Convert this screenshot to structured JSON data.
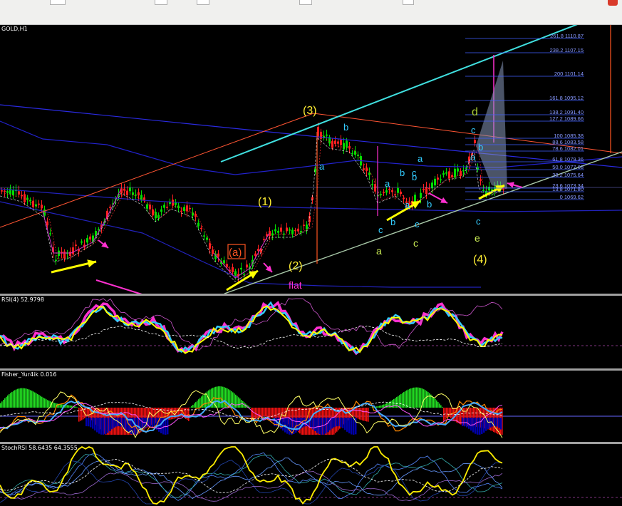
{
  "chart": {
    "symbol_label": "GOLD,H1",
    "wave_labels": {
      "w3": "(3)",
      "w1": "(1)",
      "w2": "(2)",
      "wa_paren": "(a)",
      "w4": "(4)",
      "flat": "flat",
      "d": "d",
      "a1": "a",
      "b1": "b",
      "a2": "a",
      "b2": "b",
      "c1": "c",
      "b3": "b",
      "a3": "a",
      "c2": "c",
      "b4": "b",
      "a4": "a",
      "b5": "b",
      "a5": "a",
      "b6": "b",
      "c3": "c",
      "c4": "c",
      "c5": "c",
      "a6": "a",
      "b7": "b",
      "c6": "c",
      "a_green": "a",
      "c_green": "c",
      "e_green": "e"
    },
    "fib_levels": [
      {
        "label": "261.8 1110.87"
      },
      {
        "label": "238.2 1107.15"
      },
      {
        "label": "200 1101.14"
      },
      {
        "label": "161.8 1095.12"
      },
      {
        "label": "138.2 1091.40"
      },
      {
        "label": "127.2 1089.66"
      },
      {
        "label": "100 1085.38"
      },
      {
        "label": "88.6 1083.58"
      },
      {
        "label": "78.6 1082.01"
      },
      {
        "label": "61.8 1079.36"
      },
      {
        "label": "50.0 1077.68"
      },
      {
        "label": "38.2 1075.64"
      },
      {
        "label": "23.6 1073.34"
      },
      {
        "label": "13.8 1071.80"
      },
      {
        "label": "0 1069.62"
      }
    ]
  },
  "rsi_panel": {
    "label": "RSI(4) 52.9798"
  },
  "fisher_panel": {
    "label": "Fisher_Yur4ik 0.016"
  },
  "stoch_panel": {
    "label": "StochRSI 58.6435 64.3555"
  },
  "colors": {
    "bull_candle": "#00dd00",
    "bear_candle": "#ff2020",
    "channel_upper": "#40e0e0",
    "arrow_yellow": "#ffff00",
    "arrow_magenta": "#ff30d0",
    "fib_line": "#4060ff",
    "wave_yellow": "#ffee33",
    "wave_cyan": "#33ccff",
    "wave_green": "#ccee55"
  }
}
